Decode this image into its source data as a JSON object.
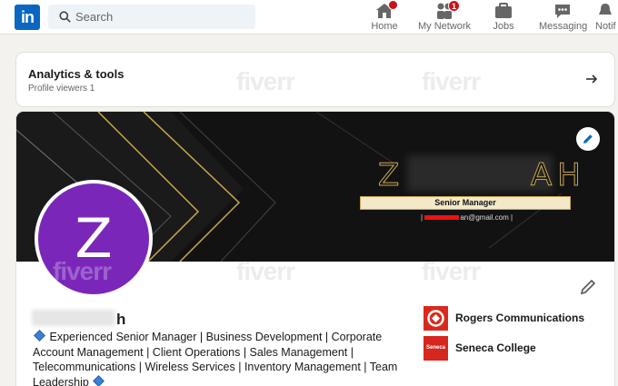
{
  "nav": {
    "logo": "in",
    "search_placeholder": "Search",
    "items": [
      {
        "label": "Home",
        "badge": ""
      },
      {
        "label": "My Network",
        "badge": "1"
      },
      {
        "label": "Jobs",
        "badge": ""
      },
      {
        "label": "Messaging",
        "badge": ""
      },
      {
        "label": "Notif",
        "badge": ""
      }
    ]
  },
  "analytics": {
    "title": "Analytics & tools",
    "subtitle": "Profile viewers 1"
  },
  "banner": {
    "name_start": "Z",
    "name_end": "AH",
    "title": "Senior Manager",
    "email_suffix": "an@gmail.com"
  },
  "profile": {
    "avatar_letter": "Z",
    "name_visible": "h",
    "headline_1": "Experienced Senior Manager | Business Development | Corporate Account Management | Client Operations | Sales Management | Telecommunications | Wireless Services | Inventory Management | Team Leadership",
    "orgs": [
      {
        "name": "Rogers Communications",
        "logo_color": "#da291c"
      },
      {
        "name": "Seneca College",
        "logo_color": "#d7261e",
        "logo_text": "Seneca"
      }
    ]
  },
  "watermark": "fiverr",
  "colors": {
    "accent": "#0a66c2",
    "avatar": "#7a27b9",
    "badge": "#cc1016"
  }
}
